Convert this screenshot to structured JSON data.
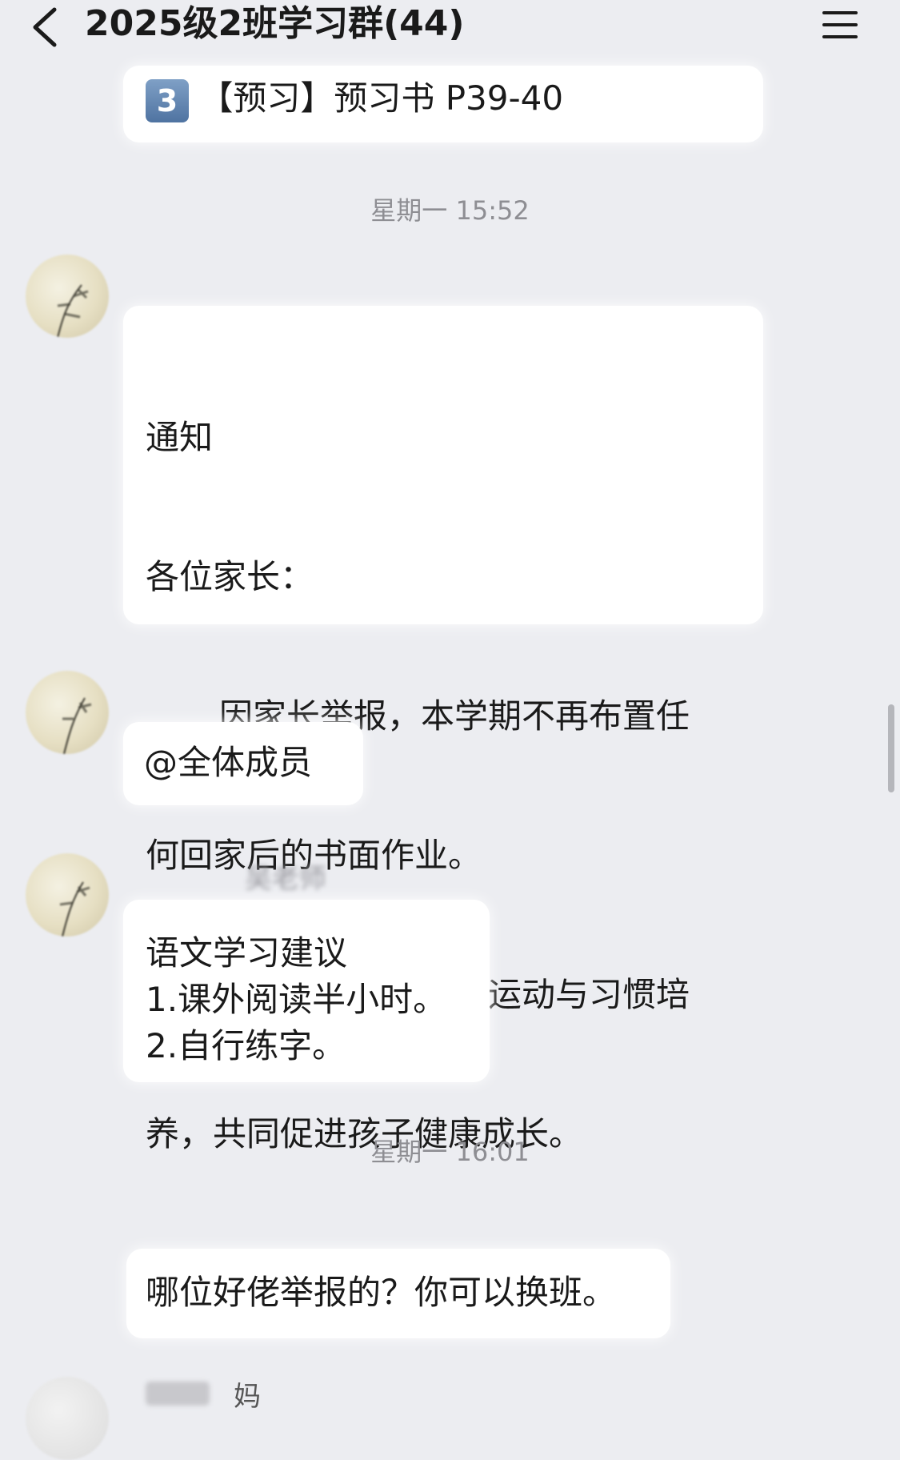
{
  "header": {
    "title": "2025级2班学习群(44)",
    "back_icon": "chevron-left-icon",
    "menu_icon": "hamburger-menu-icon"
  },
  "messages": {
    "m1": {
      "number_badge": "3",
      "text": "【预习】预习书 P39-40"
    },
    "time1": "星期一 15:52",
    "m2": {
      "line1": "通知",
      "line2": "各位家长：",
      "line3": "因家长举报，本学期不再布置任",
      "line4": "何回家后的书面作业。",
      "line5": "请关注孩子阅读、运动与习惯培",
      "line6": "养，共同促进孩子健康成长。"
    },
    "m3": {
      "text": "@全体成员"
    },
    "m4": {
      "sender": "吴老师",
      "line1": "语文学习建议",
      "line2": "1.课外阅读半小时。",
      "line3": "2.自行练字。"
    },
    "time2": "星期一 16:01",
    "m5": {
      "text": "哪位好佬举报的？你可以换班。"
    },
    "m6": {
      "sender": "妈"
    }
  },
  "colors": {
    "background": "#ecedf1",
    "bubble": "#ffffff",
    "text": "#1a1a1a",
    "timestamp": "#8e8e93"
  }
}
